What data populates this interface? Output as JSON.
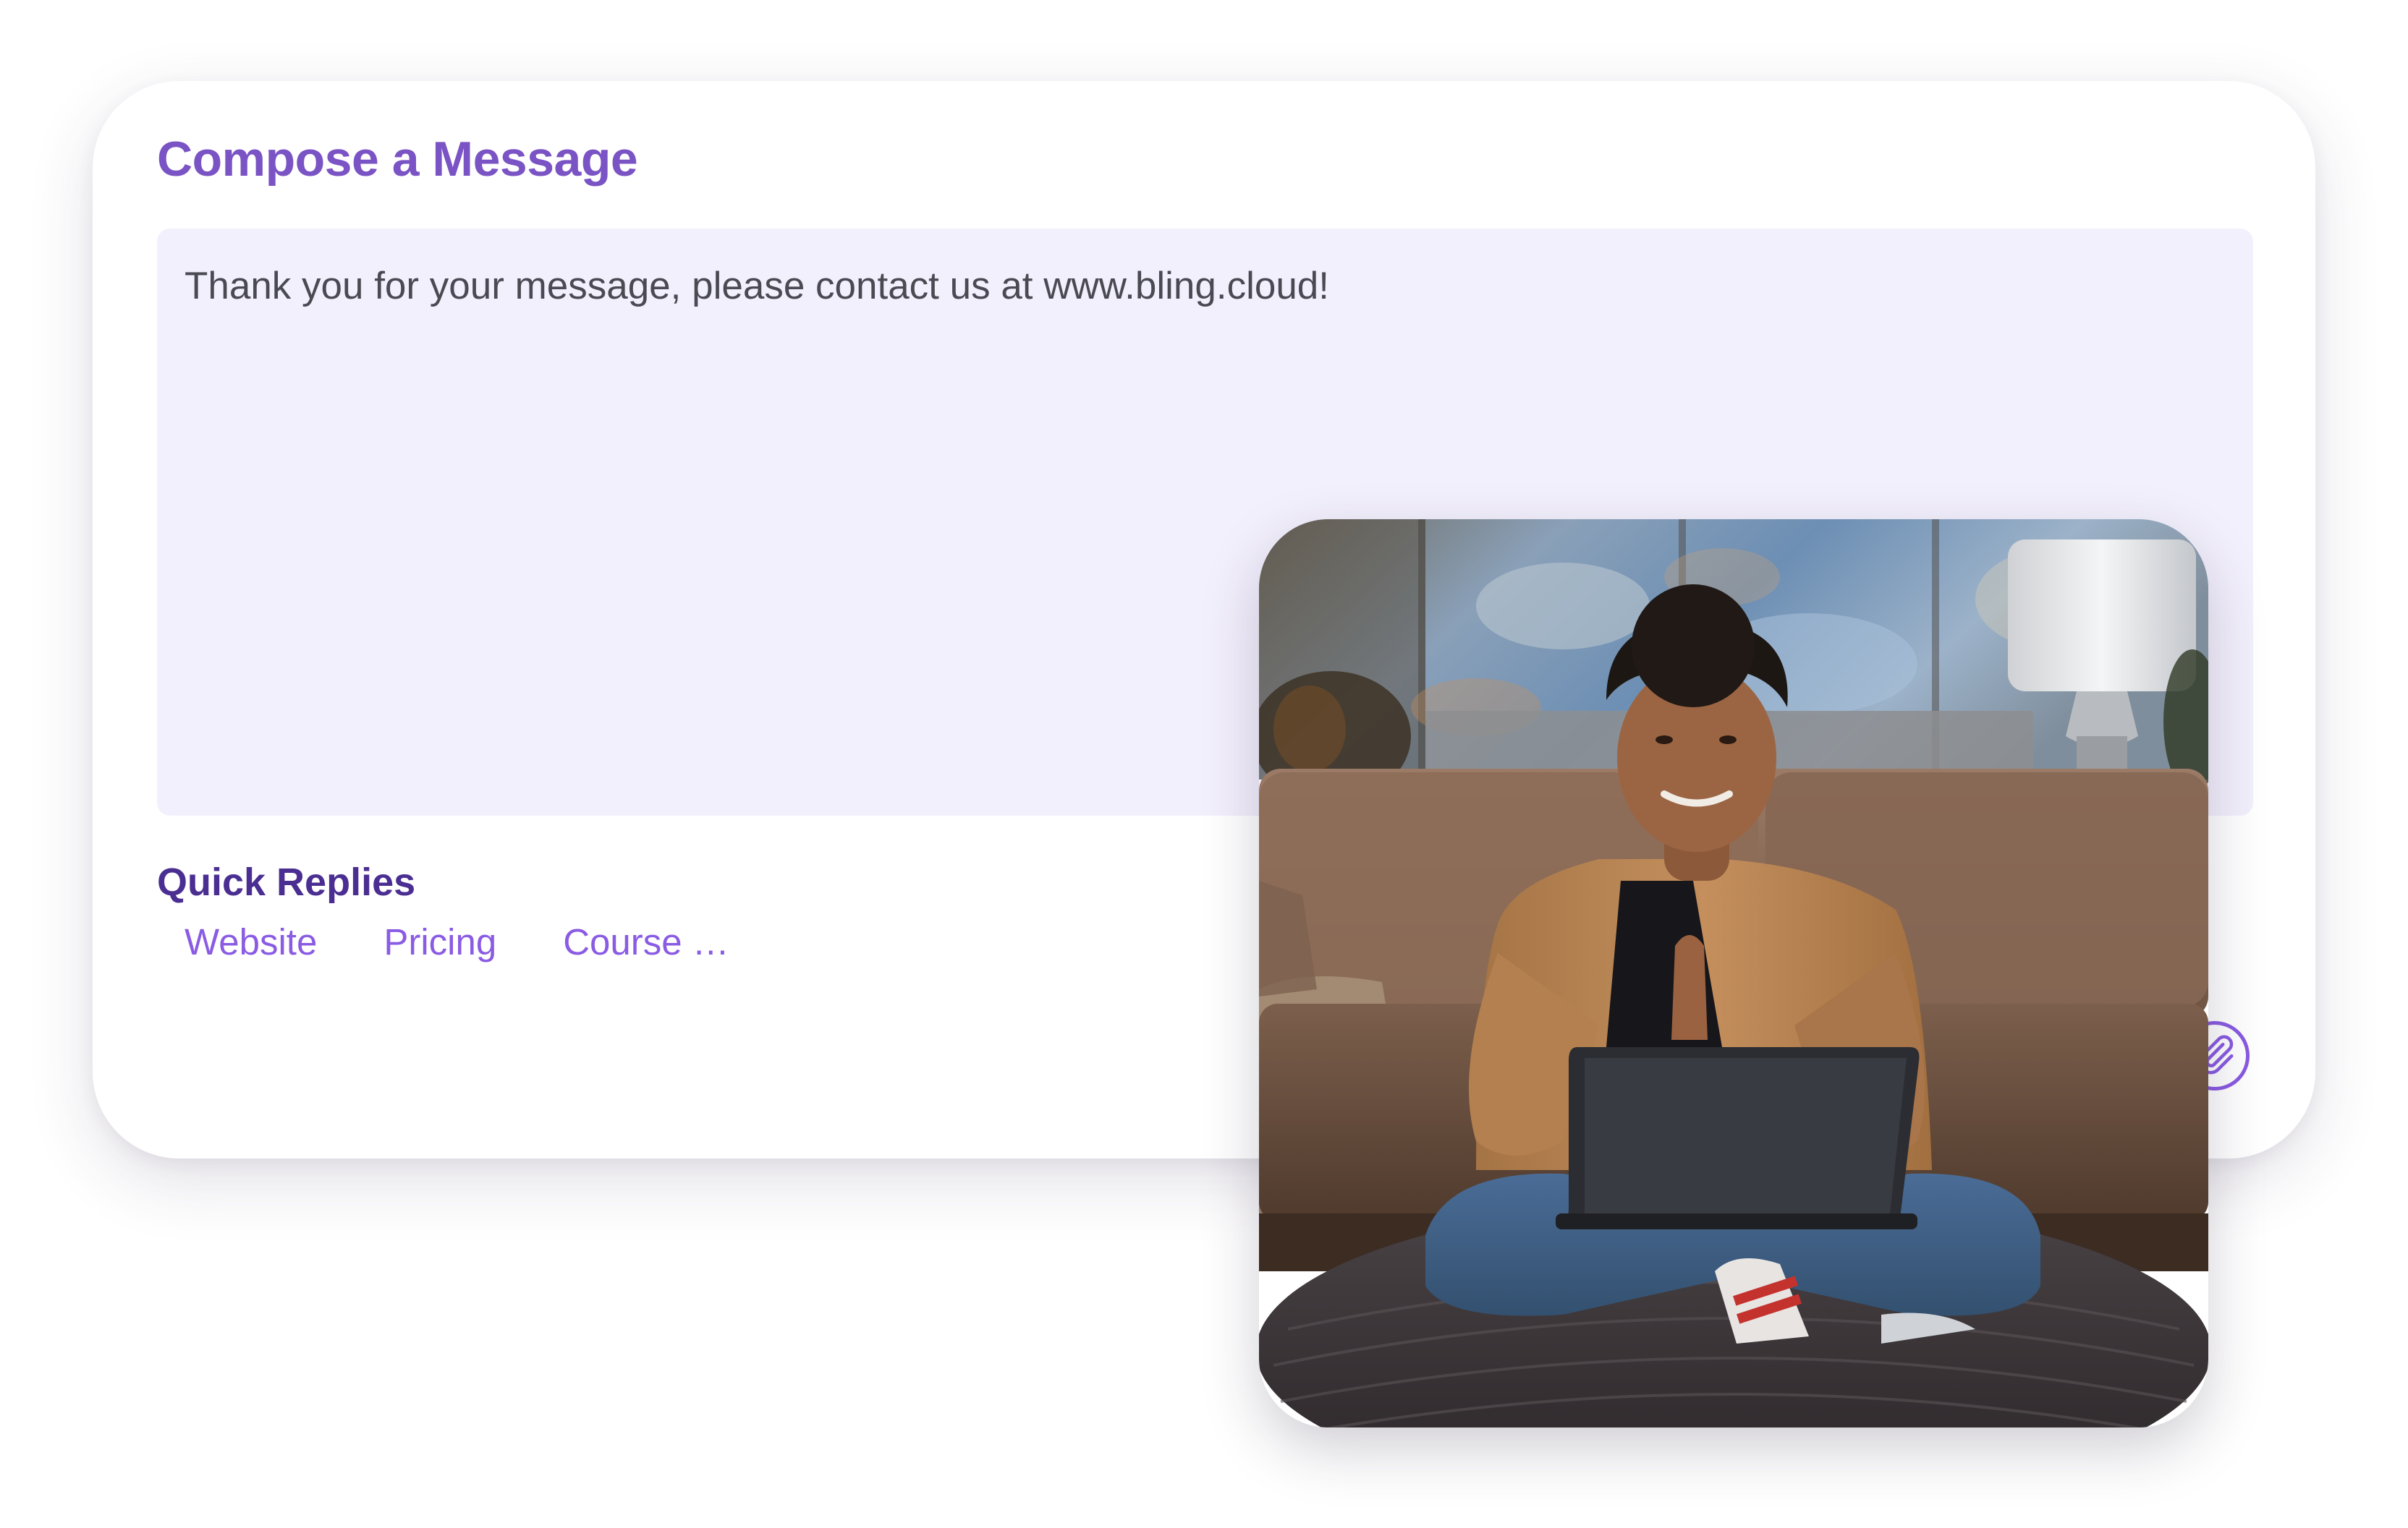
{
  "composer": {
    "title": "Compose a Message",
    "message": "Thank you for your message, please contact us at www.bling.cloud!"
  },
  "quick_replies": {
    "heading": "Quick Replies",
    "items": [
      {
        "label": "Website"
      },
      {
        "label": "Pricing"
      },
      {
        "label": "Course …"
      }
    ]
  },
  "icons": {
    "attach": "paperclip-icon"
  },
  "colors": {
    "title": "#7a53c4",
    "heading": "#4b2e92",
    "accent": "#8a5be3",
    "input_background": "#f3f0fd",
    "text": "#4a4a52"
  }
}
